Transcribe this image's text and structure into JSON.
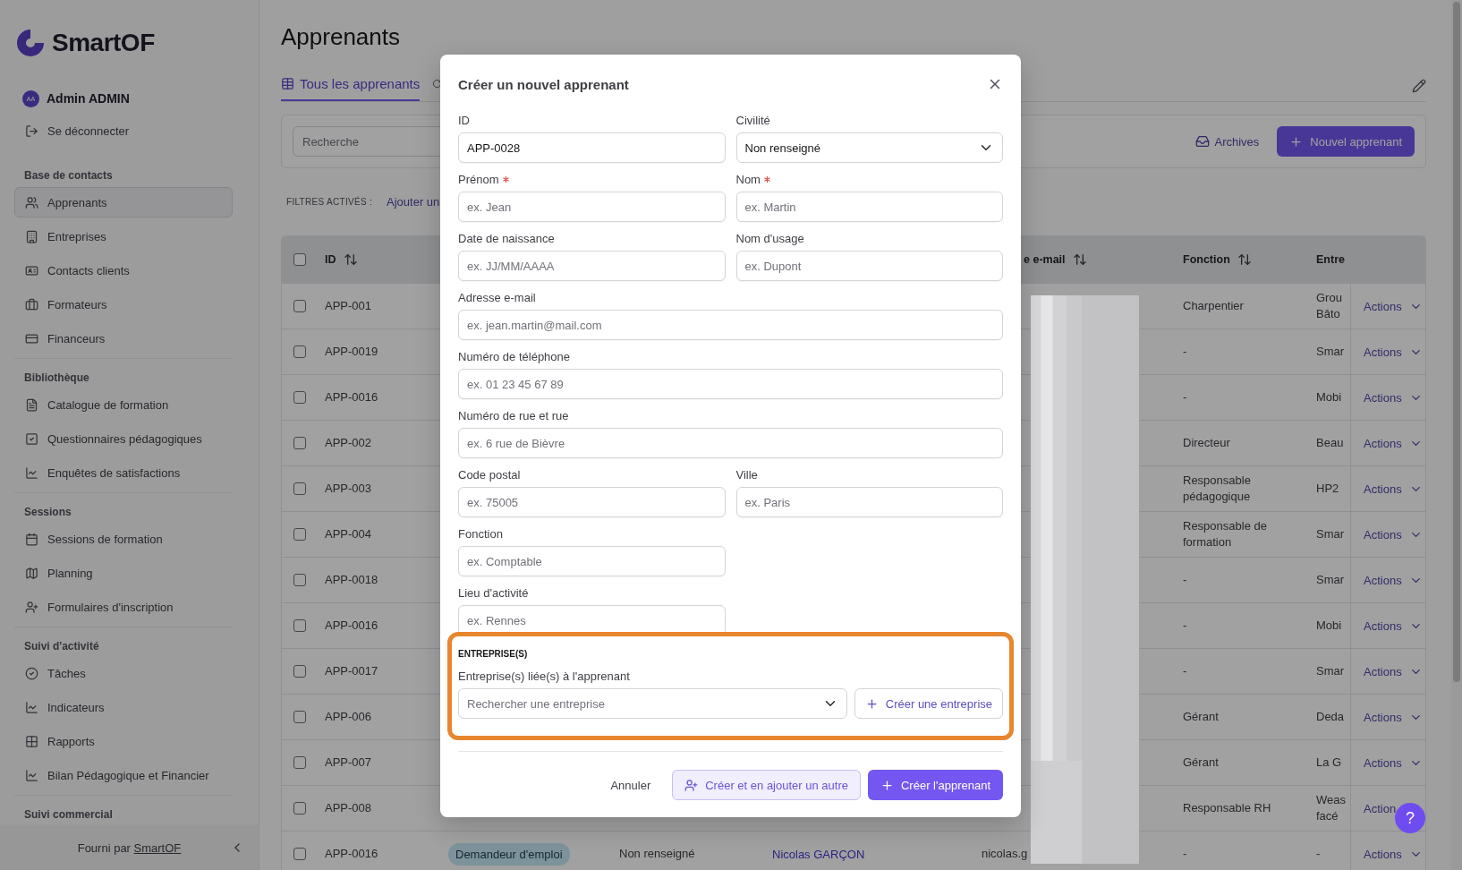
{
  "sidebar": {
    "logo": "SmartOF",
    "user": {
      "initials": "AA",
      "name": "Admin ADMIN"
    },
    "logout": "Se déconnecter",
    "sections": [
      {
        "title": "Base de contacts",
        "items": [
          {
            "label": "Apprenants",
            "selected": true
          },
          {
            "label": "Entreprises",
            "selected": false
          },
          {
            "label": "Contacts clients",
            "selected": false
          },
          {
            "label": "Formateurs",
            "selected": false
          },
          {
            "label": "Financeurs",
            "selected": false
          }
        ]
      },
      {
        "title": "Bibliothèque",
        "items": [
          {
            "label": "Catalogue de formation",
            "selected": false
          },
          {
            "label": "Questionnaires pédagogiques",
            "selected": false
          },
          {
            "label": "Enquêtes de satisfactions",
            "selected": false
          }
        ]
      },
      {
        "title": "Sessions",
        "items": [
          {
            "label": "Sessions de formation",
            "selected": false
          },
          {
            "label": "Planning",
            "selected": false
          },
          {
            "label": "Formulaires d'inscription",
            "selected": false
          }
        ]
      },
      {
        "title": "Suivi d'activité",
        "items": [
          {
            "label": "Tâches",
            "selected": false
          },
          {
            "label": "Indicateurs",
            "selected": false
          },
          {
            "label": "Rapports",
            "selected": false
          },
          {
            "label": "Bilan Pédagogique et Financier",
            "selected": false
          }
        ]
      },
      {
        "title": "Suivi commercial"
      }
    ],
    "footer": {
      "text": "Fourni par",
      "link": "SmartOF"
    }
  },
  "page": {
    "title": "Apprenants",
    "tabs": [
      {
        "label": "Tous les apprenants",
        "selected": true
      },
      {
        "selected": false
      }
    ],
    "search": {
      "placeholder": "Recherche"
    },
    "archives": "Archives",
    "new_button": "Nouvel apprenant",
    "filters": {
      "label": "FILTRES ACTIVÉS :",
      "add": "Ajouter un"
    }
  },
  "table": {
    "all_checked": false,
    "columns": [
      {
        "kind": "id",
        "label": "ID"
      },
      {
        "kind": "email",
        "label": "e e-mail"
      },
      {
        "kind": "fonction",
        "label": "Fonction"
      },
      {
        "kind": "entreprise",
        "label": "Entre"
      }
    ],
    "rows": [
      {
        "checked": false,
        "id": "APP-001",
        "fonction": "Charpentier",
        "entreprise": "Grou Bâto",
        "action": "Actions"
      },
      {
        "checked": false,
        "id": "APP-0019",
        "fonction": "-",
        "entreprise": "Smar",
        "action": "Actions"
      },
      {
        "checked": false,
        "id": "APP-0016",
        "fonction": "-",
        "entreprise": "Mobi",
        "action": "Actions"
      },
      {
        "checked": false,
        "id": "APP-002",
        "fonction": "Directeur",
        "entreprise": "Beau",
        "action": "Actions"
      },
      {
        "checked": false,
        "id": "APP-003",
        "fonction": "Responsable pédagogique",
        "entreprise": "HP2",
        "action": "Actions"
      },
      {
        "checked": false,
        "id": "APP-004",
        "fonction": "Responsable de formation",
        "entreprise": "Smar",
        "action": "Actions"
      },
      {
        "checked": false,
        "id": "APP-0018",
        "fonction": "-",
        "entreprise": "Smar",
        "action": "Actions"
      },
      {
        "checked": false,
        "id": "APP-0016",
        "fonction": "-",
        "entreprise": "Mobi",
        "action": "Actions"
      },
      {
        "checked": false,
        "id": "APP-0017",
        "fonction": "-",
        "entreprise": "Smar",
        "action": "Actions"
      },
      {
        "checked": false,
        "id": "APP-006",
        "fonction": "Gérant",
        "entreprise": "Deda",
        "action": "Actions"
      },
      {
        "checked": false,
        "id": "APP-007",
        "fonction": "Gérant",
        "entreprise": "La G",
        "action": "Actions"
      },
      {
        "checked": false,
        "id": "APP-008",
        "fonction": "Responsable RH",
        "entreprise": "Weas facé",
        "action": "Action",
        "caret": false
      },
      {
        "checked": false,
        "id": "APP-0016",
        "status": {
          "label": "Demandeur d'emploi"
        },
        "civility": "Non renseigné",
        "name": "Nicolas GARÇON",
        "email": "nicolas.g",
        "fonction": "-",
        "entreprise": "-",
        "action": "Actions"
      }
    ]
  },
  "modal": {
    "title": "Créer un nouvel apprenant",
    "rows": [
      [
        {
          "kind": "text",
          "label": "ID",
          "value": "APP-0028"
        },
        {
          "kind": "select",
          "label": "Civilité",
          "value": "Non renseigné"
        }
      ],
      [
        {
          "kind": "text",
          "label": "Prénom",
          "placeholder": "ex. Jean",
          "required": true
        },
        {
          "kind": "text",
          "label": "Nom",
          "placeholder": "ex. Martin",
          "required": true
        }
      ],
      [
        {
          "kind": "text",
          "label": "Date de naissance",
          "placeholder": "ex. JJ/MM/AAAA"
        },
        {
          "kind": "text",
          "label": "Nom d'usage",
          "placeholder": "ex. Dupont"
        }
      ],
      [
        {
          "kind": "text",
          "label": "Adresse e-mail",
          "placeholder": "ex. jean.martin@mail.com",
          "wide": true
        }
      ],
      [
        {
          "kind": "text",
          "label": "Numéro de téléphone",
          "placeholder": "ex. 01 23 45 67 89",
          "wide": true
        }
      ],
      [
        {
          "kind": "text",
          "label": "Numéro de rue et rue",
          "placeholder": "ex. 6 rue de Bièvre",
          "wide": true
        }
      ],
      [
        {
          "kind": "text",
          "label": "Code postal",
          "placeholder": "ex. 75005"
        },
        {
          "kind": "text",
          "label": "Ville",
          "placeholder": "ex. Paris"
        }
      ],
      [
        {
          "kind": "text",
          "label": "Fonction",
          "placeholder": "ex. Comptable"
        }
      ],
      [
        {
          "kind": "text",
          "label": "Lieu d'activité",
          "placeholder": "ex. Rennes"
        }
      ]
    ],
    "company": {
      "title": "ENTREPRISE(S)",
      "label": "Entreprise(s) liée(s) à l'apprenant",
      "placeholder": "Rechercher une entreprise",
      "create": "Créer une entreprise"
    },
    "actions": {
      "cancel": "Annuler",
      "secondary": "Créer et en ajouter un autre",
      "primary": "Créer l'apprenant"
    }
  },
  "help": "?"
}
